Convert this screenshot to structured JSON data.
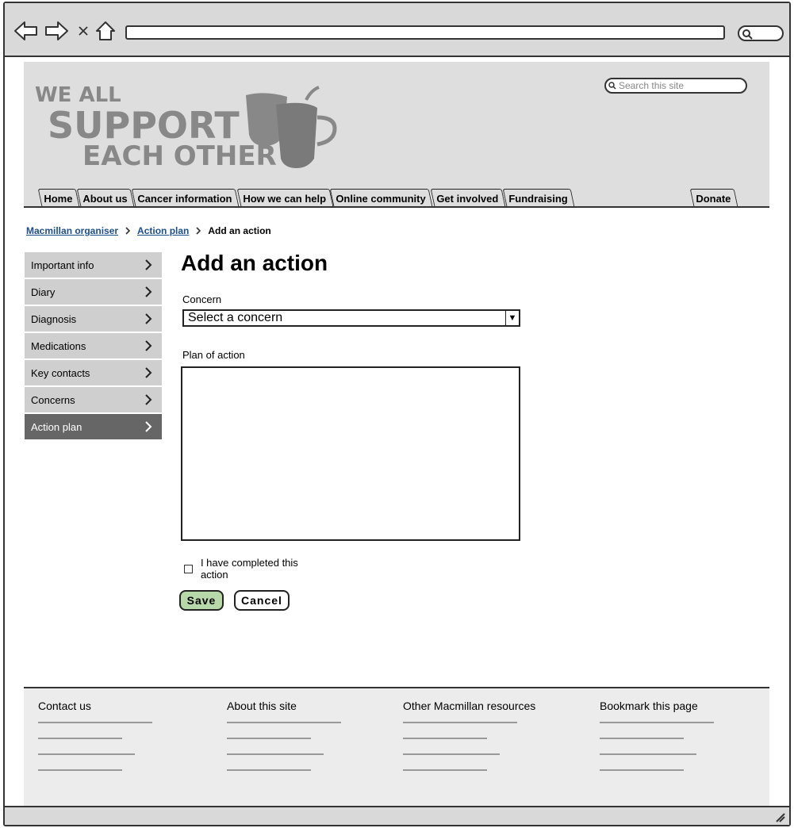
{
  "header": {
    "search_placeholder": "Search this site",
    "logo_text": "WE ALL SUPPORT EACH OTHER"
  },
  "nav": {
    "tabs": [
      "Home",
      "About us",
      "Cancer information",
      "How we can help",
      "Online community",
      "Get involved",
      "Fundraising"
    ],
    "donate_label": "Donate"
  },
  "breadcrumb": {
    "items": [
      "Macmillan organiser",
      "Action plan"
    ],
    "current": "Add an action"
  },
  "sidebar": {
    "items": [
      {
        "label": "Important info",
        "active": false
      },
      {
        "label": "Diary",
        "active": false
      },
      {
        "label": "Diagnosis",
        "active": false
      },
      {
        "label": "Medications",
        "active": false
      },
      {
        "label": "Key contacts",
        "active": false
      },
      {
        "label": "Concerns",
        "active": false
      },
      {
        "label": "Action plan",
        "active": true
      }
    ]
  },
  "main": {
    "title": "Add an action",
    "concern_label": "Concern",
    "concern_value": "Select a concern",
    "plan_label": "Plan of action",
    "completed_label": "I have completed this action",
    "completed_checked": false,
    "save_label": "Save",
    "cancel_label": "Cancel"
  },
  "footer": {
    "columns": [
      {
        "title": "Contact us"
      },
      {
        "title": "About this site"
      },
      {
        "title": "Other Macmillan resources"
      },
      {
        "title": "Bookmark this page"
      }
    ]
  },
  "colors": {
    "header_bg": "#dedede",
    "sidebar_active": "#666666",
    "save_button": "#b7d8a8",
    "link": "#1c4f8a"
  }
}
